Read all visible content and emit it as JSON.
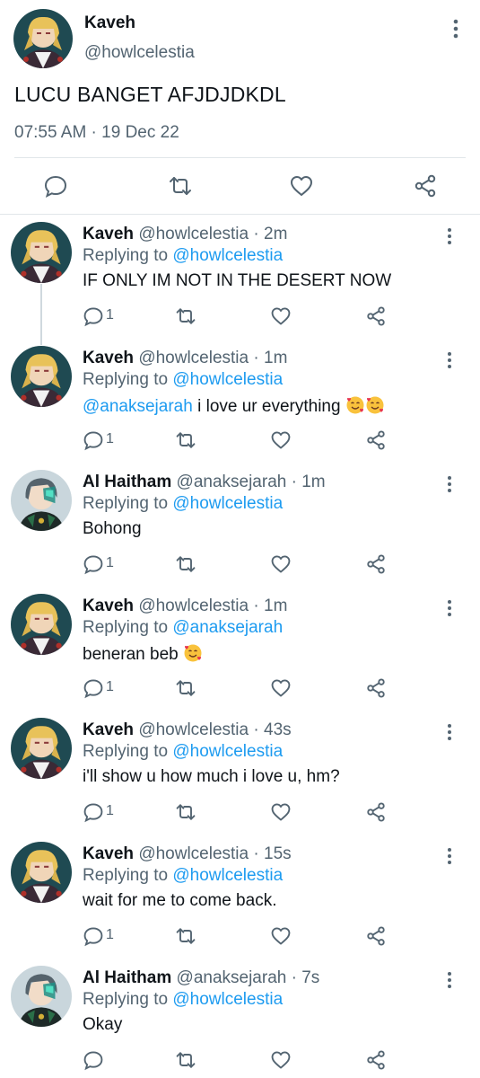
{
  "main_tweet": {
    "name": "Kaveh",
    "handle": "@howlcelestia",
    "text": "LUCU BANGET AFJDJDKDL",
    "timestamp": "07:55 AM · 19 Dec 22",
    "actions": [
      "reply-icon",
      "retweet-icon",
      "like-icon",
      "share-icon"
    ]
  },
  "replies": [
    {
      "name": "Kaveh",
      "handle": "@howlcelestia",
      "dot": "·",
      "time": "2m",
      "replying_prefix": "Replying to ",
      "replying_to": "@howlcelestia",
      "text": "IF ONLY IM NOT IN THE DESERT NOW",
      "reply_count": "1"
    },
    {
      "name": "Kaveh",
      "handle": "@howlcelestia",
      "dot": "·",
      "time": "1m",
      "replying_prefix": "Replying to ",
      "replying_to": "@howlcelestia",
      "mention": "@anaksejarah",
      "text": " i love ur everything ",
      "emoji": "smiling-face-with-hearts x2",
      "reply_count": "1"
    },
    {
      "name": "Al Haitham",
      "handle": "@anaksejarah",
      "dot": "·",
      "time": "1m",
      "replying_prefix": "Replying to ",
      "replying_to": "@howlcelestia",
      "text": "Bohong",
      "reply_count": "1"
    },
    {
      "name": "Kaveh",
      "handle": "@howlcelestia",
      "dot": "·",
      "time": "1m",
      "replying_prefix": "Replying to ",
      "replying_to": "@anaksejarah",
      "text": "beneran beb ",
      "emoji": "smiling-face-with-hearts",
      "reply_count": "1"
    },
    {
      "name": "Kaveh",
      "handle": "@howlcelestia",
      "dot": "·",
      "time": "43s",
      "replying_prefix": "Replying to ",
      "replying_to": "@howlcelestia",
      "text": "i'll show u how much i love u, hm?",
      "reply_count": "1"
    },
    {
      "name": "Kaveh",
      "handle": "@howlcelestia",
      "dot": "·",
      "time": "15s",
      "replying_prefix": "Replying to ",
      "replying_to": "@howlcelestia",
      "text": "wait for me to come back.",
      "reply_count": "1"
    },
    {
      "name": "Al Haitham",
      "handle": "@anaksejarah",
      "dot": "·",
      "time": "7s",
      "replying_prefix": "Replying to ",
      "replying_to": "@howlcelestia",
      "text": "Okay",
      "reply_count": ""
    }
  ],
  "colors": {
    "link": "#1d9bf0",
    "secondary_text": "#536471",
    "primary_text": "#0f1419",
    "divider": "#e1e6ea"
  }
}
